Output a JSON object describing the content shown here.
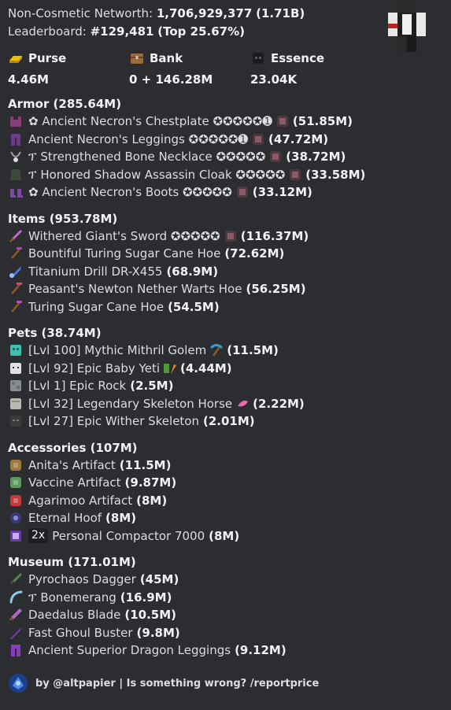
{
  "header": {
    "networth_label": "Non-Cosmetic Networth:",
    "networth_value": "1,706,929,377",
    "networth_short": "(1.71B)",
    "leaderboard_label": "Leaderboard:",
    "leaderboard_rank": "#129,481",
    "leaderboard_top": "(Top 25.67%)"
  },
  "stats": [
    {
      "label": "Purse",
      "value": "4.46M",
      "icon": "gold-ingot-icon"
    },
    {
      "label": "Bank",
      "value": "0 + 146.28M",
      "icon": "chest-icon"
    },
    {
      "label": "Essence",
      "value": "23.04K",
      "icon": "wither-skull-icon"
    }
  ],
  "sections": [
    {
      "title": "Armor (285.64M)",
      "items": [
        {
          "icon": "chestplate-icon",
          "color": "#8a3d7a",
          "prefix": "✿ ",
          "name": "Ancient Necron's Chestplate ✪✪✪✪✪➊",
          "extra_icon": "gemstone-icon",
          "value": "(51.85M)"
        },
        {
          "icon": "leggings-icon",
          "color": "#6b3a8a",
          "prefix": "",
          "name": "Ancient Necron's Leggings ✪✪✪✪✪➊",
          "extra_icon": "gemstone-icon",
          "value": "(47.72M)"
        },
        {
          "icon": "necklace-icon",
          "color": "#9aa0a6",
          "prefix": "ፕ ",
          "name": "Strengthened Bone Necklace ✪✪✪✪✪",
          "extra_icon": "gemstone-icon",
          "value": "(38.72M)"
        },
        {
          "icon": "cloak-icon",
          "color": "#3c4a3a",
          "prefix": "ፕ ",
          "name": "Honored Shadow Assassin Cloak ✪✪✪✪✪",
          "extra_icon": "gemstone-icon",
          "value": "(33.58M)"
        },
        {
          "icon": "boots-icon",
          "color": "#7a4aa0",
          "prefix": "✿ ",
          "name": "Ancient Necron's Boots ✪✪✪✪✪",
          "extra_icon": "gemstone-icon",
          "value": "(33.12M)"
        }
      ]
    },
    {
      "title": "Items (953.78M)",
      "items": [
        {
          "icon": "sword-icon",
          "color": "#c86ad8",
          "prefix": "",
          "name": "Withered Giant's Sword ✪✪✪✪✪",
          "extra_icon": "gemstone-icon",
          "value": "(116.37M)"
        },
        {
          "icon": "hoe-icon",
          "color": "#a04aa8",
          "prefix": "",
          "name": "Bountiful Turing Sugar Cane Hoe",
          "extra_icon": "",
          "value": "(72.62M)"
        },
        {
          "icon": "drill-icon",
          "color": "#4a7ad8",
          "prefix": "",
          "name": "Titanium Drill DR-X455",
          "extra_icon": "",
          "value": "(68.9M)"
        },
        {
          "icon": "hoe-icon",
          "color": "#d84a6a",
          "prefix": "",
          "name": "Peasant's Newton Nether Warts Hoe",
          "extra_icon": "",
          "value": "(56.25M)"
        },
        {
          "icon": "hoe-icon",
          "color": "#b84ac0",
          "prefix": "",
          "name": "Turing Sugar Cane Hoe",
          "extra_icon": "",
          "value": "(54.5M)"
        }
      ]
    },
    {
      "title": "Pets (38.74M)",
      "items": [
        {
          "icon": "golem-pet-icon",
          "color": "#3fbfb0",
          "prefix": "",
          "name": "[Lvl 100] Mythic Mithril Golem",
          "extra_icon": "pickaxe-icon",
          "value": "(11.5M)"
        },
        {
          "icon": "yeti-pet-icon",
          "color": "#dfe3e8",
          "prefix": "",
          "name": "[Lvl 92] Epic Baby Yeti",
          "extra_icon": "slime-carrot-icon",
          "value": "(4.44M)"
        },
        {
          "icon": "rock-pet-icon",
          "color": "#8a8d91",
          "prefix": "",
          "name": "[Lvl 1] Epic Rock",
          "extra_icon": "",
          "value": "(2.5M)"
        },
        {
          "icon": "skeleton-horse-icon",
          "color": "#b8bab0",
          "prefix": "",
          "name": "[Lvl 32] Legendary Skeleton Horse",
          "extra_icon": "pink-item-icon",
          "value": "(2.22M)"
        },
        {
          "icon": "wither-skeleton-icon",
          "color": "#3a3b3d",
          "prefix": "",
          "name": "[Lvl 27] Epic Wither Skeleton",
          "extra_icon": "",
          "value": "(2.01M)"
        }
      ]
    },
    {
      "title": "Accessories (107M)",
      "items": [
        {
          "icon": "artifact-icon",
          "color": "#a07a3a",
          "qty": "",
          "name": "Anita's Artifact",
          "value": "(11.5M)"
        },
        {
          "icon": "artifact-icon",
          "color": "#5a9a5a",
          "qty": "",
          "name": "Vaccine Artifact",
          "value": "(9.87M)"
        },
        {
          "icon": "artifact-icon",
          "color": "#c83a3a",
          "qty": "",
          "name": "Agarimoo Artifact",
          "value": "(8M)"
        },
        {
          "icon": "hoof-icon",
          "color": "#3a3a7a",
          "qty": "",
          "name": "Eternal Hoof",
          "value": "(8M)"
        },
        {
          "icon": "compactor-icon",
          "color": "#6a3aa0",
          "qty": "2x",
          "name": "Personal Compactor 7000",
          "value": "(8M)"
        }
      ]
    },
    {
      "title": "Museum (171.01M)",
      "items": [
        {
          "icon": "dagger-icon",
          "color": "#5a8a5a",
          "prefix": "",
          "name": "Pyrochaos Dagger",
          "value": "(45M)"
        },
        {
          "icon": "bonemerang-icon",
          "color": "#8ac8e8",
          "prefix": "ፕ ",
          "name": "Bonemerang",
          "value": "(16.9M)"
        },
        {
          "icon": "blade-icon",
          "color": "#b06ac0",
          "prefix": "",
          "name": "Daedalus Blade",
          "value": "(10.5M)"
        },
        {
          "icon": "buster-icon",
          "color": "#7a3ab0",
          "prefix": "",
          "name": "Fast Ghoul Buster",
          "value": "(9.8M)"
        },
        {
          "icon": "leggings-icon",
          "color": "#8a3ac0",
          "prefix": "",
          "name": "Ancient Superior Dragon Leggings",
          "value": "(9.12M)"
        }
      ]
    }
  ],
  "footer": {
    "text": "by @altpapier | Is something wrong? /reportprice",
    "icon": "author-avatar-icon"
  }
}
